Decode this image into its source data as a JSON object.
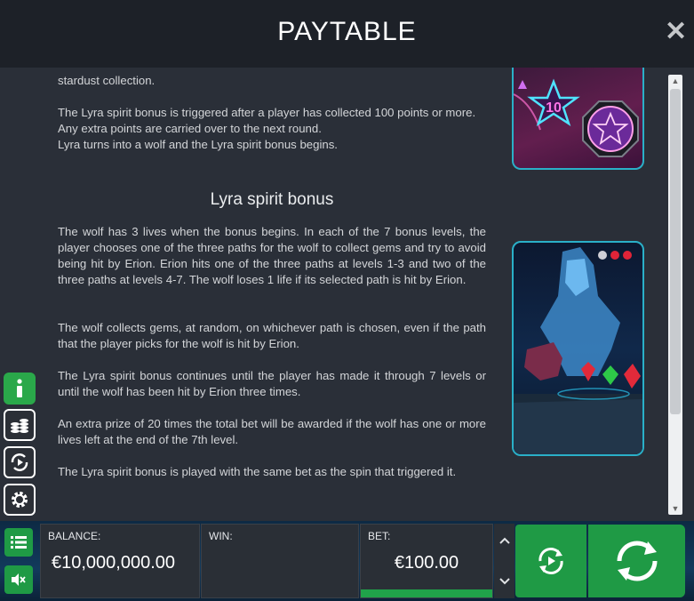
{
  "header": {
    "title": "PAYTABLE",
    "close_icon": "close-icon"
  },
  "content": {
    "para_stardust": "stardust collection.",
    "para_trigger": "The Lyra spirit bonus is triggered after a player has collected 100 points or more. Any extra points are carried over to the next round.",
    "para_wolf_turn": "Lyra turns into a wolf and the Lyra spirit bonus begins.",
    "heading": "Lyra spirit bonus",
    "para_lives": "The wolf has 3 lives when the bonus begins. In each of the 7 bonus levels, the player chooses one of the three paths for the wolf to collect gems and try to avoid being hit by Erion. Erion hits one of the three paths at levels 1-3 and two of the three paths at levels 4-7. The wolf loses 1 life if its selected path is hit by Erion.",
    "para_gems": "The wolf collects gems, at random, on whichever path is chosen, even if the path that the player picks for the wolf is hit by Erion.",
    "para_continues": "The Lyra spirit bonus continues until the player has made it through 7 levels or until the wolf has been hit by Erion three times.",
    "para_prize": "An extra prize of 20 times the total bet will be awarded if the wolf has one or more lives left at the end of the 7th level.",
    "para_same_bet": "The Lyra spirit bonus is played with the same bet as the spin that triggered it.",
    "art1_star_number": "10"
  },
  "sidebar": {
    "icons": [
      "info-icon",
      "coins-icon",
      "autoplay-icon",
      "settings-icon"
    ]
  },
  "footer": {
    "balance_label": "BALANCE:",
    "balance_value": "€10,000,000.00",
    "win_label": "WIN:",
    "win_value": "",
    "bet_label": "BET:",
    "bet_value": "€100.00",
    "accent_color": "#1f9a45"
  }
}
